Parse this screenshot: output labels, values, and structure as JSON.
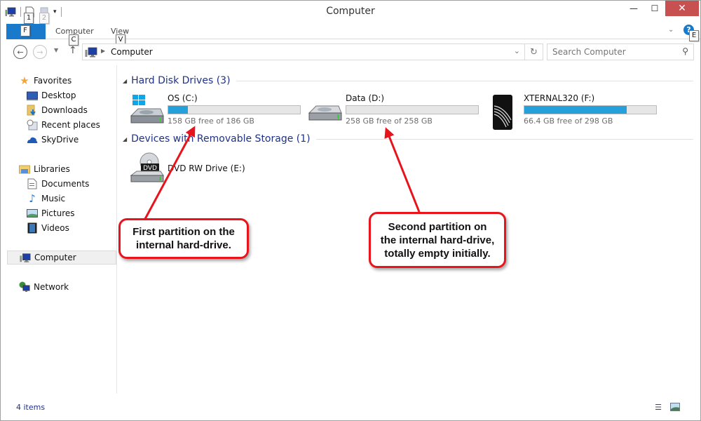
{
  "window": {
    "title": "Computer",
    "controls": {
      "minimize": "—",
      "maximize": "☐",
      "close": "✕"
    }
  },
  "quick_access": {
    "keytips": [
      "1",
      "2"
    ]
  },
  "ribbon": {
    "file_label": "",
    "file_keytip": "F",
    "tabs": [
      {
        "label": "Computer",
        "keytip": "C"
      },
      {
        "label": "View",
        "keytip": "V"
      }
    ],
    "help_keytip": "E"
  },
  "address_bar": {
    "breadcrumb": "Computer",
    "search_placeholder": "Search Computer"
  },
  "sidebar": {
    "favorites": {
      "label": "Favorites",
      "items": [
        {
          "label": "Desktop",
          "icon": "desktop-icon"
        },
        {
          "label": "Downloads",
          "icon": "downloads-folder-icon"
        },
        {
          "label": "Recent places",
          "icon": "recent-places-icon"
        },
        {
          "label": "SkyDrive",
          "icon": "skydrive-cloud-icon"
        }
      ]
    },
    "libraries": {
      "label": "Libraries",
      "items": [
        {
          "label": "Documents",
          "icon": "documents-icon"
        },
        {
          "label": "Music",
          "icon": "music-note-icon"
        },
        {
          "label": "Pictures",
          "icon": "pictures-icon"
        },
        {
          "label": "Videos",
          "icon": "videos-film-icon"
        }
      ]
    },
    "computer": {
      "label": "Computer",
      "selected": true
    },
    "network": {
      "label": "Network"
    }
  },
  "content": {
    "groups": [
      {
        "label": "Hard Disk Drives (3)",
        "drives": [
          {
            "name": "OS (C:)",
            "free_text": "158 GB free of 186 GB",
            "used_fraction": 0.151,
            "icon": "windows-drive-icon"
          },
          {
            "name": "Data (D:)",
            "free_text": "258 GB free of 258 GB",
            "used_fraction": 0.0,
            "icon": "hard-drive-icon"
          },
          {
            "name": "XTERNAL320 (F:)",
            "free_text": "66.4 GB free of 298 GB",
            "used_fraction": 0.777,
            "icon": "external-drive-icon"
          }
        ]
      },
      {
        "label": "Devices with Removable Storage (1)",
        "drives": [
          {
            "name": "DVD RW Drive (E:)",
            "icon": "dvd-drive-icon"
          }
        ]
      }
    ]
  },
  "status_bar": {
    "item_count": "4 items"
  },
  "annotations": [
    {
      "text_lines": [
        "First partition on the",
        "internal hard-drive."
      ]
    },
    {
      "text_lines": [
        "Second partition on",
        "the internal hard-drive,",
        "totally empty initially."
      ]
    }
  ],
  "colors": {
    "accent": "#1979ca",
    "bar_fill": "#26a0da",
    "group_header": "#1e3287",
    "callout_border": "#e8141c",
    "close_button": "#c75050"
  }
}
